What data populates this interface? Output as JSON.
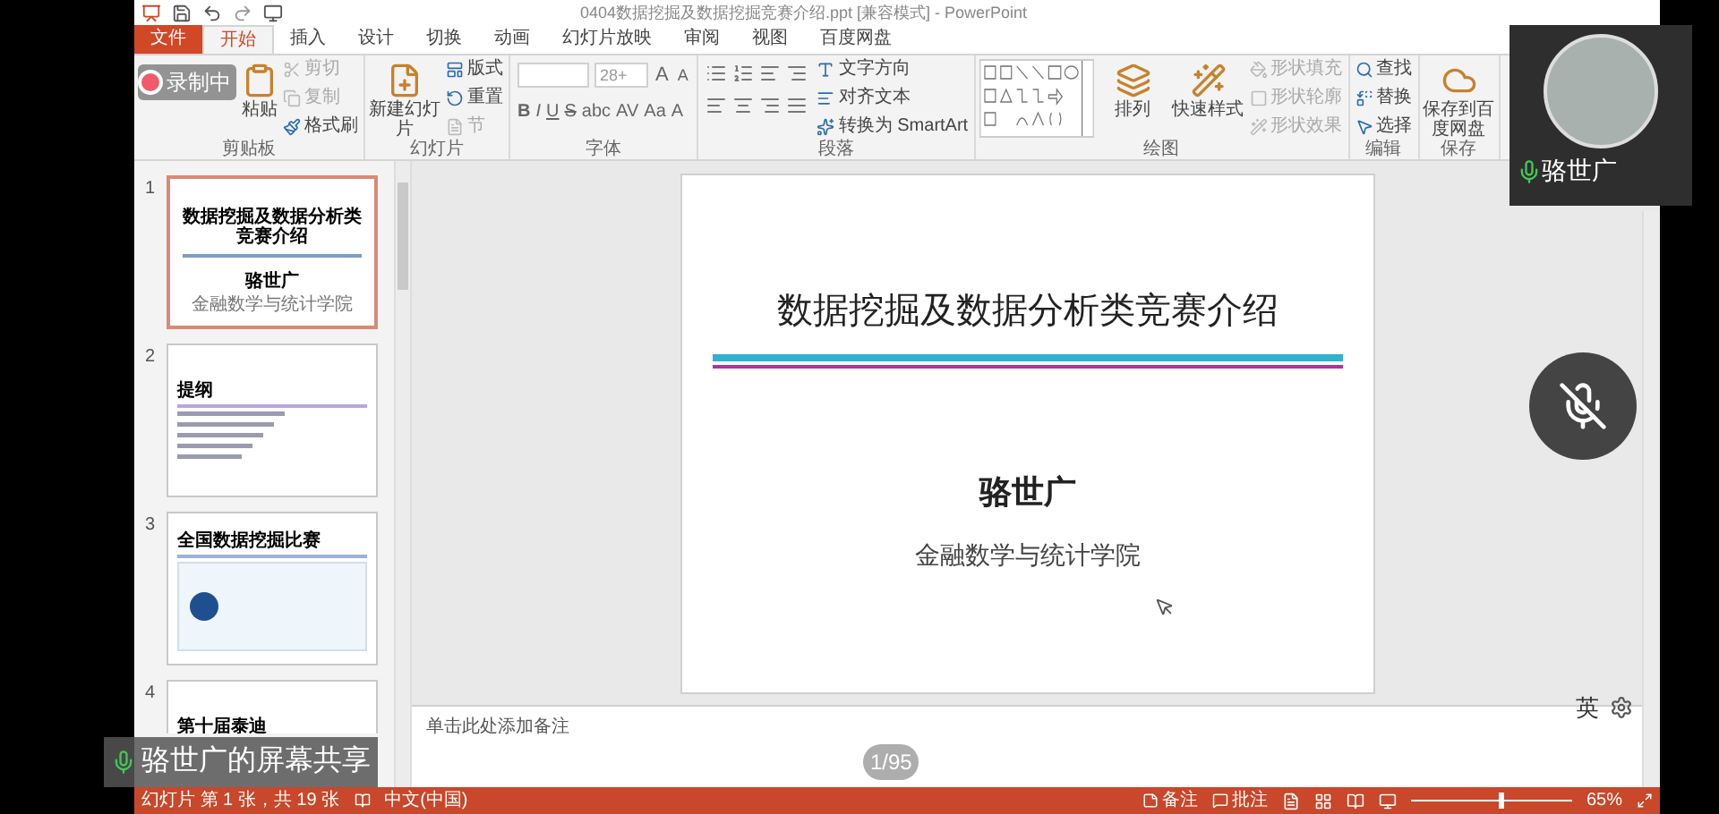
{
  "window": {
    "title": "0404数据挖掘及数据挖掘竞赛介绍.ppt [兼容模式] - PowerPoint"
  },
  "tabs": [
    {
      "label": "文件",
      "selected": false,
      "kind": "file"
    },
    {
      "label": "开始",
      "selected": true,
      "kind": "tab"
    },
    {
      "label": "插入",
      "selected": false,
      "kind": "tab"
    },
    {
      "label": "设计",
      "selected": false,
      "kind": "tab"
    },
    {
      "label": "切换",
      "selected": false,
      "kind": "tab"
    },
    {
      "label": "动画",
      "selected": false,
      "kind": "tab"
    },
    {
      "label": "幻灯片放映",
      "selected": false,
      "kind": "tab"
    },
    {
      "label": "审阅",
      "selected": false,
      "kind": "tab"
    },
    {
      "label": "视图",
      "selected": false,
      "kind": "tab"
    },
    {
      "label": "百度网盘",
      "selected": false,
      "kind": "tab"
    }
  ],
  "ribbon": {
    "groups": [
      {
        "label": "剪贴板",
        "items": [
          {
            "kind": "large",
            "label": "粘贴"
          },
          {
            "kind": "stack",
            "entries": [
              {
                "label": "剪切",
                "disabled": true
              },
              {
                "label": "复制",
                "disabled": true
              },
              {
                "label": "格式刷",
                "disabled": false
              }
            ]
          }
        ]
      },
      {
        "label": "幻灯片",
        "items": [
          {
            "kind": "large",
            "label": "新建幻灯片"
          },
          {
            "kind": "stack",
            "entries": [
              {
                "label": "版式",
                "disabled": false
              },
              {
                "label": "重置",
                "disabled": false
              },
              {
                "label": "节",
                "disabled": true
              }
            ]
          }
        ]
      },
      {
        "label": "字体",
        "items": [
          {
            "kind": "font",
            "size": "28+",
            "buttons": [
              "A",
              "A",
              "B",
              "I",
              "U",
              "S",
              "abc",
              "AV",
              "Aa",
              "A"
            ]
          }
        ]
      },
      {
        "label": "段落",
        "items": [
          {
            "kind": "paragraph"
          },
          {
            "kind": "stack",
            "entries": [
              {
                "label": "文字方向",
                "disabled": false
              },
              {
                "label": "对齐文本",
                "disabled": false
              },
              {
                "label": "转换为 SmartArt",
                "disabled": false
              }
            ]
          }
        ]
      },
      {
        "label": "绘图",
        "items": [
          {
            "kind": "gallery"
          },
          {
            "kind": "large",
            "label": "排列"
          },
          {
            "kind": "large",
            "label": "快速样式"
          },
          {
            "kind": "stack",
            "entries": [
              {
                "label": "形状填充",
                "disabled": true
              },
              {
                "label": "形状轮廓",
                "disabled": true
              },
              {
                "label": "形状效果",
                "disabled": true
              }
            ]
          }
        ]
      },
      {
        "label": "编辑",
        "items": [
          {
            "kind": "stack",
            "entries": [
              {
                "label": "查找",
                "disabled": false
              },
              {
                "label": "替换",
                "disabled": false
              },
              {
                "label": "选择",
                "disabled": false
              }
            ]
          }
        ]
      },
      {
        "label": "保存",
        "items": [
          {
            "kind": "large",
            "label": "保存到百度网盘"
          }
        ]
      }
    ]
  },
  "slides_pane": {
    "slides": [
      {
        "number": "1",
        "selected": true,
        "kind": "title",
        "title": "数据挖掘及数据分析类竞赛介绍",
        "author": "骆世广",
        "affiliation": "金融数学与统计学院"
      },
      {
        "number": "2",
        "selected": false,
        "kind": "list",
        "title": "提纲"
      },
      {
        "number": "3",
        "selected": false,
        "kind": "web",
        "title": "全国数据挖掘比赛"
      },
      {
        "number": "4",
        "selected": false,
        "kind": "list",
        "title": "第十届泰迪"
      }
    ]
  },
  "slide": {
    "title": "数据挖掘及数据分析类竞赛介绍",
    "author": "骆世广",
    "affiliation": "金融数学与统计学院"
  },
  "notes": {
    "placeholder": "单击此处添加备注"
  },
  "status_bar": {
    "slide_info": "幻灯片 第 1 张，共 19 张",
    "language": "中文(中国)",
    "notes": "备注",
    "comments": "批注",
    "zoom": {
      "level": 0.55,
      "reading": "65%"
    }
  },
  "overlay": {
    "recording": "录制中",
    "participant": {
      "name": "骆世广"
    },
    "mic_muted": true,
    "share_label": "骆世广的屏幕共享",
    "page_counter": "1/95",
    "ime": "英"
  }
}
